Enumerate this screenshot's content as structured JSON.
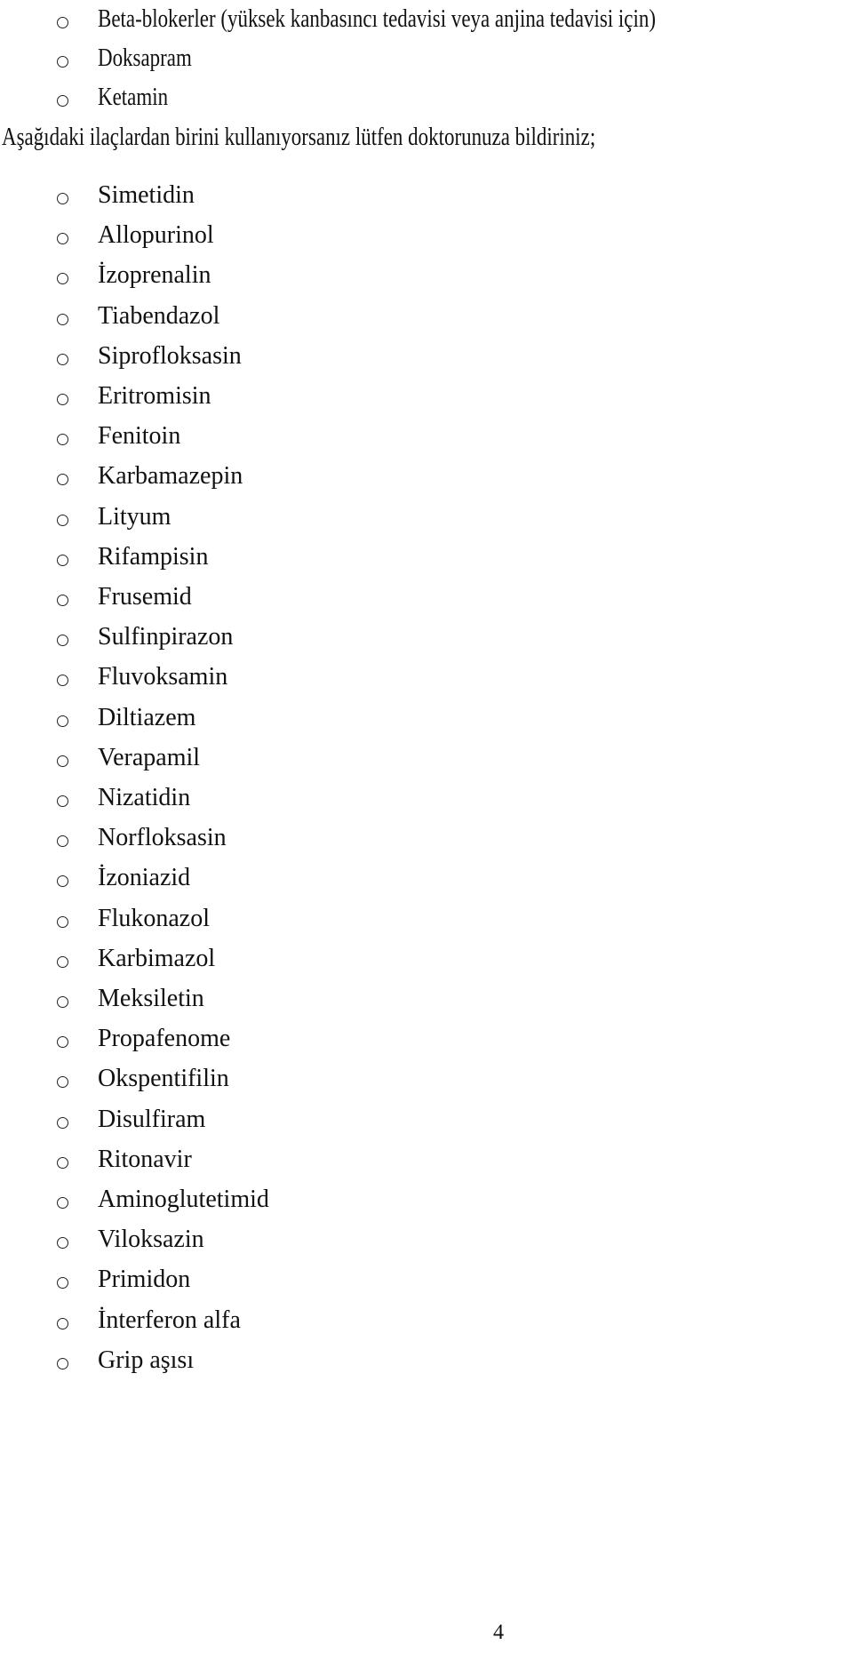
{
  "document": {
    "intro_items": [
      "Beta-blokerler (yüksek kanbasıncı tedavisi veya anjina tedavisi için)",
      "Doksapram",
      "Ketamin"
    ],
    "paragraph": "Aşağıdaki ilaçlardan birini kullanıyorsanız lütfen doktorunuza bildiriniz;",
    "drug_list": [
      "Simetidin",
      "Allopurinol",
      "İzoprenalin",
      "Tiabendazol",
      "Siprofloksasin",
      "Eritromisin",
      "Fenitoin",
      "Karbamazepin",
      "Lityum",
      "Rifampisin",
      "Frusemid",
      "Sulfinpirazon",
      "Fluvoksamin",
      "Diltiazem",
      "Verapamil",
      "Nizatidin",
      "Norfloksasin",
      "İzoniazid",
      "Flukonazol",
      "Karbimazol",
      "Meksiletin",
      "Propafenome",
      "Okspentifilin",
      "Disulfiram",
      "Ritonavir",
      "Aminoglutetimid",
      "Viloksazin",
      "Primidon",
      "İnterferon alfa",
      "Grip aşısı"
    ],
    "bullet_icon": "hollow-circle-bullet",
    "page_number": "4"
  }
}
